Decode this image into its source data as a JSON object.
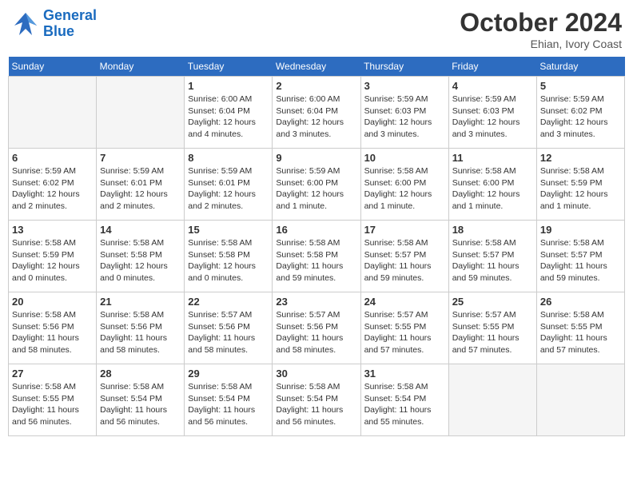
{
  "header": {
    "logo": {
      "line1": "General",
      "line2": "Blue"
    },
    "title": "October 2024",
    "location": "Ehian, Ivory Coast"
  },
  "weekdays": [
    "Sunday",
    "Monday",
    "Tuesday",
    "Wednesday",
    "Thursday",
    "Friday",
    "Saturday"
  ],
  "weeks": [
    [
      {
        "day": "",
        "empty": true
      },
      {
        "day": "",
        "empty": true
      },
      {
        "day": "1",
        "sunrise": "Sunrise: 6:00 AM",
        "sunset": "Sunset: 6:04 PM",
        "daylight": "Daylight: 12 hours and 4 minutes."
      },
      {
        "day": "2",
        "sunrise": "Sunrise: 6:00 AM",
        "sunset": "Sunset: 6:04 PM",
        "daylight": "Daylight: 12 hours and 3 minutes."
      },
      {
        "day": "3",
        "sunrise": "Sunrise: 5:59 AM",
        "sunset": "Sunset: 6:03 PM",
        "daylight": "Daylight: 12 hours and 3 minutes."
      },
      {
        "day": "4",
        "sunrise": "Sunrise: 5:59 AM",
        "sunset": "Sunset: 6:03 PM",
        "daylight": "Daylight: 12 hours and 3 minutes."
      },
      {
        "day": "5",
        "sunrise": "Sunrise: 5:59 AM",
        "sunset": "Sunset: 6:02 PM",
        "daylight": "Daylight: 12 hours and 3 minutes."
      }
    ],
    [
      {
        "day": "6",
        "sunrise": "Sunrise: 5:59 AM",
        "sunset": "Sunset: 6:02 PM",
        "daylight": "Daylight: 12 hours and 2 minutes."
      },
      {
        "day": "7",
        "sunrise": "Sunrise: 5:59 AM",
        "sunset": "Sunset: 6:01 PM",
        "daylight": "Daylight: 12 hours and 2 minutes."
      },
      {
        "day": "8",
        "sunrise": "Sunrise: 5:59 AM",
        "sunset": "Sunset: 6:01 PM",
        "daylight": "Daylight: 12 hours and 2 minutes."
      },
      {
        "day": "9",
        "sunrise": "Sunrise: 5:59 AM",
        "sunset": "Sunset: 6:00 PM",
        "daylight": "Daylight: 12 hours and 1 minute."
      },
      {
        "day": "10",
        "sunrise": "Sunrise: 5:58 AM",
        "sunset": "Sunset: 6:00 PM",
        "daylight": "Daylight: 12 hours and 1 minute."
      },
      {
        "day": "11",
        "sunrise": "Sunrise: 5:58 AM",
        "sunset": "Sunset: 6:00 PM",
        "daylight": "Daylight: 12 hours and 1 minute."
      },
      {
        "day": "12",
        "sunrise": "Sunrise: 5:58 AM",
        "sunset": "Sunset: 5:59 PM",
        "daylight": "Daylight: 12 hours and 1 minute."
      }
    ],
    [
      {
        "day": "13",
        "sunrise": "Sunrise: 5:58 AM",
        "sunset": "Sunset: 5:59 PM",
        "daylight": "Daylight: 12 hours and 0 minutes."
      },
      {
        "day": "14",
        "sunrise": "Sunrise: 5:58 AM",
        "sunset": "Sunset: 5:58 PM",
        "daylight": "Daylight: 12 hours and 0 minutes."
      },
      {
        "day": "15",
        "sunrise": "Sunrise: 5:58 AM",
        "sunset": "Sunset: 5:58 PM",
        "daylight": "Daylight: 12 hours and 0 minutes."
      },
      {
        "day": "16",
        "sunrise": "Sunrise: 5:58 AM",
        "sunset": "Sunset: 5:58 PM",
        "daylight": "Daylight: 11 hours and 59 minutes."
      },
      {
        "day": "17",
        "sunrise": "Sunrise: 5:58 AM",
        "sunset": "Sunset: 5:57 PM",
        "daylight": "Daylight: 11 hours and 59 minutes."
      },
      {
        "day": "18",
        "sunrise": "Sunrise: 5:58 AM",
        "sunset": "Sunset: 5:57 PM",
        "daylight": "Daylight: 11 hours and 59 minutes."
      },
      {
        "day": "19",
        "sunrise": "Sunrise: 5:58 AM",
        "sunset": "Sunset: 5:57 PM",
        "daylight": "Daylight: 11 hours and 59 minutes."
      }
    ],
    [
      {
        "day": "20",
        "sunrise": "Sunrise: 5:58 AM",
        "sunset": "Sunset: 5:56 PM",
        "daylight": "Daylight: 11 hours and 58 minutes."
      },
      {
        "day": "21",
        "sunrise": "Sunrise: 5:58 AM",
        "sunset": "Sunset: 5:56 PM",
        "daylight": "Daylight: 11 hours and 58 minutes."
      },
      {
        "day": "22",
        "sunrise": "Sunrise: 5:57 AM",
        "sunset": "Sunset: 5:56 PM",
        "daylight": "Daylight: 11 hours and 58 minutes."
      },
      {
        "day": "23",
        "sunrise": "Sunrise: 5:57 AM",
        "sunset": "Sunset: 5:56 PM",
        "daylight": "Daylight: 11 hours and 58 minutes."
      },
      {
        "day": "24",
        "sunrise": "Sunrise: 5:57 AM",
        "sunset": "Sunset: 5:55 PM",
        "daylight": "Daylight: 11 hours and 57 minutes."
      },
      {
        "day": "25",
        "sunrise": "Sunrise: 5:57 AM",
        "sunset": "Sunset: 5:55 PM",
        "daylight": "Daylight: 11 hours and 57 minutes."
      },
      {
        "day": "26",
        "sunrise": "Sunrise: 5:58 AM",
        "sunset": "Sunset: 5:55 PM",
        "daylight": "Daylight: 11 hours and 57 minutes."
      }
    ],
    [
      {
        "day": "27",
        "sunrise": "Sunrise: 5:58 AM",
        "sunset": "Sunset: 5:55 PM",
        "daylight": "Daylight: 11 hours and 56 minutes."
      },
      {
        "day": "28",
        "sunrise": "Sunrise: 5:58 AM",
        "sunset": "Sunset: 5:54 PM",
        "daylight": "Daylight: 11 hours and 56 minutes."
      },
      {
        "day": "29",
        "sunrise": "Sunrise: 5:58 AM",
        "sunset": "Sunset: 5:54 PM",
        "daylight": "Daylight: 11 hours and 56 minutes."
      },
      {
        "day": "30",
        "sunrise": "Sunrise: 5:58 AM",
        "sunset": "Sunset: 5:54 PM",
        "daylight": "Daylight: 11 hours and 56 minutes."
      },
      {
        "day": "31",
        "sunrise": "Sunrise: 5:58 AM",
        "sunset": "Sunset: 5:54 PM",
        "daylight": "Daylight: 11 hours and 55 minutes."
      },
      {
        "day": "",
        "empty": true
      },
      {
        "day": "",
        "empty": true
      }
    ]
  ]
}
